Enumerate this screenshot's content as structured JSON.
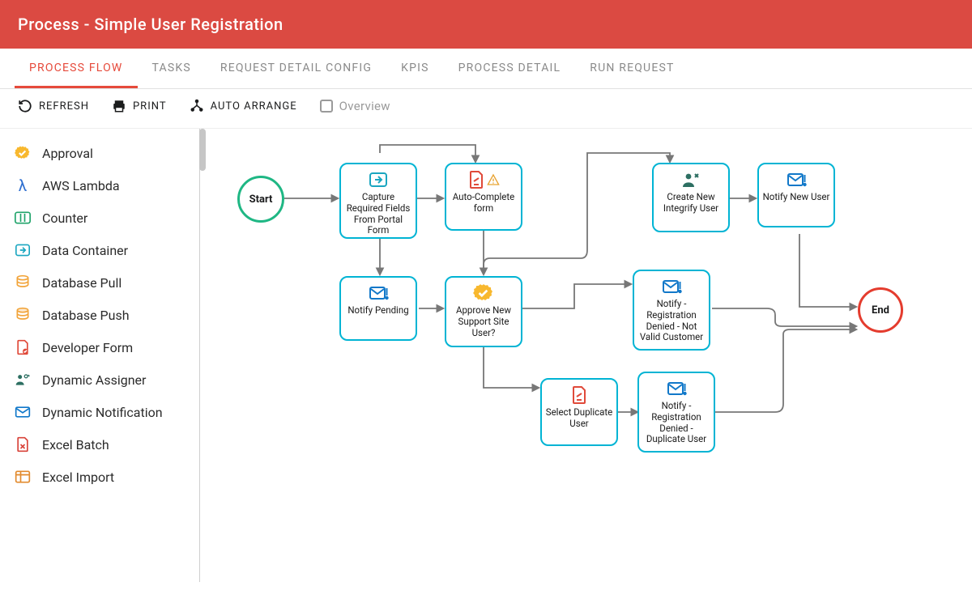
{
  "header": {
    "title": "Process - Simple User Registration"
  },
  "tabs": [
    {
      "label": "PROCESS FLOW",
      "active": true
    },
    {
      "label": "TASKS"
    },
    {
      "label": "REQUEST DETAIL CONFIG"
    },
    {
      "label": "KPIS"
    },
    {
      "label": "PROCESS DETAIL"
    },
    {
      "label": "RUN REQUEST"
    }
  ],
  "toolbar": {
    "refresh": "REFRESH",
    "print": "PRINT",
    "auto_arrange": "AUTO ARRANGE",
    "overview": "Overview"
  },
  "sidebar": {
    "items": [
      {
        "label": "Approval",
        "icon": "approval",
        "color": "#f8b82e"
      },
      {
        "label": "AWS Lambda",
        "icon": "lambda",
        "color": "#2f6fd0"
      },
      {
        "label": "Counter",
        "icon": "counter",
        "color": "#1fa36a"
      },
      {
        "label": "Data Container",
        "icon": "container",
        "color": "#1aa6c0"
      },
      {
        "label": "Database Pull",
        "icon": "db-pull",
        "color": "#f2a43a"
      },
      {
        "label": "Database Push",
        "icon": "db-push",
        "color": "#f2a43a"
      },
      {
        "label": "Developer Form",
        "icon": "dev-form",
        "color": "#e04a3a"
      },
      {
        "label": "Dynamic Assigner",
        "icon": "assigner",
        "color": "#2d6f62"
      },
      {
        "label": "Dynamic Notification",
        "icon": "notification",
        "color": "#1178c9"
      },
      {
        "label": "Excel Batch",
        "icon": "excel-batch",
        "color": "#d8433a"
      },
      {
        "label": "Excel Import",
        "icon": "excel-import",
        "color": "#e28a2d"
      }
    ]
  },
  "flow": {
    "start_label": "Start",
    "end_label": "End",
    "nodes": {
      "capture": {
        "label": "Capture Required Fields From Portal Form",
        "icon": "container",
        "color": "#1aa6c0"
      },
      "autoform": {
        "label": "Auto-Complete form",
        "icon": "dev-form",
        "color": "#e04a3a",
        "badge": "warning"
      },
      "pending": {
        "label": "Notify Pending",
        "icon": "notification",
        "color": "#1178c9"
      },
      "approve": {
        "label": "Approve New Support Site User?",
        "icon": "approval",
        "color": "#f8b82e"
      },
      "create": {
        "label": "Create New Integrify User",
        "icon": "assigner",
        "color": "#2d6f62"
      },
      "notifynew": {
        "label": "Notify New User",
        "icon": "notification",
        "color": "#1178c9"
      },
      "denied": {
        "label": "Notify - Registration Denied - Not Valid Customer",
        "icon": "notification",
        "color": "#1178c9"
      },
      "selectdup": {
        "label": "Select Duplicate User",
        "icon": "dev-form",
        "color": "#e04a3a"
      },
      "dupnotify": {
        "label": "Notify - Registration Denied - Duplicate User",
        "icon": "notification",
        "color": "#1178c9"
      }
    }
  }
}
